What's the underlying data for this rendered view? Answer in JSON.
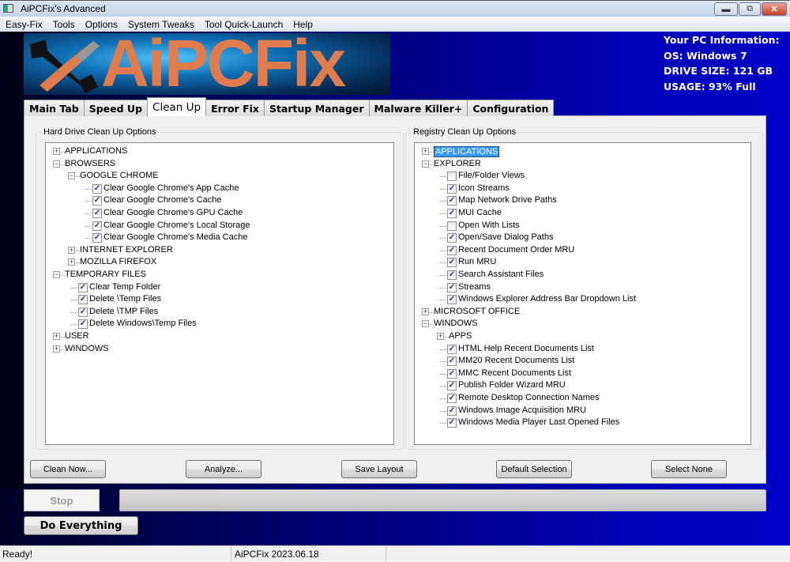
{
  "window": {
    "title": "AiPCFix's Advanced"
  },
  "menu": [
    "Easy-Fix",
    "Tools",
    "Options",
    "System Tweaks",
    "Tool Quick-Launch",
    "Help"
  ],
  "banner": {
    "logo_text": "AiPCFix"
  },
  "pc_info": {
    "heading": "Your PC Information:",
    "os": "OS: Windows 7",
    "drive": "DRIVE SIZE: 121 GB",
    "usage": "USAGE: 93% Full"
  },
  "tabs": [
    "Main Tab",
    "Speed Up",
    "Clean Up",
    "Error Fix",
    "Startup Manager",
    "Malware Killer+",
    "Configuration"
  ],
  "active_tab": "Clean Up",
  "left_group": {
    "title": "Hard Drive Clean Up Options",
    "items": [
      {
        "label": "APPLICATIONS",
        "level": 0,
        "kind": "expand"
      },
      {
        "label": "BROWSERS",
        "level": 0,
        "kind": "collapse"
      },
      {
        "label": "GOOGLE CHROME",
        "level": 1,
        "kind": "collapse"
      },
      {
        "label": "Clear Google Chrome's App Cache",
        "level": 2,
        "kind": "check",
        "checked": true
      },
      {
        "label": "Clear Google Chrome's Cache",
        "level": 2,
        "kind": "check",
        "checked": true
      },
      {
        "label": "Clear Google Chrome's GPU Cache",
        "level": 2,
        "kind": "check",
        "checked": true
      },
      {
        "label": "Clear Google Chrome's Local Storage",
        "level": 2,
        "kind": "check",
        "checked": true
      },
      {
        "label": "Clear Google Chrome's Media Cache",
        "level": 2,
        "kind": "check",
        "checked": true
      },
      {
        "label": "INTERNET EXPLORER",
        "level": 1,
        "kind": "expand"
      },
      {
        "label": "MOZILLA FIREFOX",
        "level": 1,
        "kind": "expand"
      },
      {
        "label": "TEMPORARY FILES",
        "level": 0,
        "kind": "collapse"
      },
      {
        "label": "Clear Temp Folder",
        "level": 1,
        "kind": "check",
        "checked": true
      },
      {
        "label": "Delete \\Temp Files",
        "level": 1,
        "kind": "check",
        "checked": true
      },
      {
        "label": "Delete \\TMP Files",
        "level": 1,
        "kind": "check",
        "checked": true
      },
      {
        "label": "Delete Windows\\Temp Files",
        "level": 1,
        "kind": "check",
        "checked": true
      },
      {
        "label": "USER",
        "level": 0,
        "kind": "expand"
      },
      {
        "label": "WINDOWS",
        "level": 0,
        "kind": "expand"
      }
    ]
  },
  "right_group": {
    "title": "Registry Clean Up Options",
    "items": [
      {
        "label": "APPLICATIONS",
        "level": 0,
        "kind": "expand",
        "selected": true
      },
      {
        "label": "EXPLORER",
        "level": 0,
        "kind": "collapse"
      },
      {
        "label": "File/Folder Views",
        "level": 1,
        "kind": "check",
        "checked": false
      },
      {
        "label": "Icon Streams",
        "level": 1,
        "kind": "check",
        "checked": true
      },
      {
        "label": "Map Network Drive Paths",
        "level": 1,
        "kind": "check",
        "checked": true
      },
      {
        "label": "MUI Cache",
        "level": 1,
        "kind": "check",
        "checked": true
      },
      {
        "label": "Open With Lists",
        "level": 1,
        "kind": "check",
        "checked": false
      },
      {
        "label": "Open/Save Dialog Paths",
        "level": 1,
        "kind": "check",
        "checked": true
      },
      {
        "label": "Recent Document Order MRU",
        "level": 1,
        "kind": "check",
        "checked": true
      },
      {
        "label": "Run MRU",
        "level": 1,
        "kind": "check",
        "checked": true
      },
      {
        "label": "Search Assistant Files",
        "level": 1,
        "kind": "check",
        "checked": true
      },
      {
        "label": "Streams",
        "level": 1,
        "kind": "check",
        "checked": true
      },
      {
        "label": "Windows Explorer Address Bar Dropdown List",
        "level": 1,
        "kind": "check",
        "checked": true
      },
      {
        "label": "MICROSOFT OFFICE",
        "level": 0,
        "kind": "expand"
      },
      {
        "label": "WINDOWS",
        "level": 0,
        "kind": "collapse"
      },
      {
        "label": "APPS",
        "level": 1,
        "kind": "expand"
      },
      {
        "label": "HTML Help Recent Documents List",
        "level": 1,
        "kind": "check",
        "checked": true
      },
      {
        "label": "MM20 Recent Documents List",
        "level": 1,
        "kind": "check",
        "checked": true
      },
      {
        "label": "MMC Recent Documents List",
        "level": 1,
        "kind": "check",
        "checked": true
      },
      {
        "label": "Publish Folder Wizard MRU",
        "level": 1,
        "kind": "check",
        "checked": true
      },
      {
        "label": "Remote Desktop Connection Names",
        "level": 1,
        "kind": "check",
        "checked": true
      },
      {
        "label": "Windows Image Acquisition MRU",
        "level": 1,
        "kind": "check",
        "checked": true
      },
      {
        "label": "Windows Media Player Last Opened Files",
        "level": 1,
        "kind": "check",
        "checked": true
      }
    ]
  },
  "buttons": {
    "clean_now": "Clean Now...",
    "analyze": "Analyze...",
    "save_layout": "Save Layout",
    "default_selection": "Default Selection",
    "select_none": "Select None",
    "stop": "Stop",
    "do_everything": "Do Everything"
  },
  "progress": 0,
  "status": {
    "left": "Ready!",
    "version": "AiPCFix 2023.06.18"
  }
}
